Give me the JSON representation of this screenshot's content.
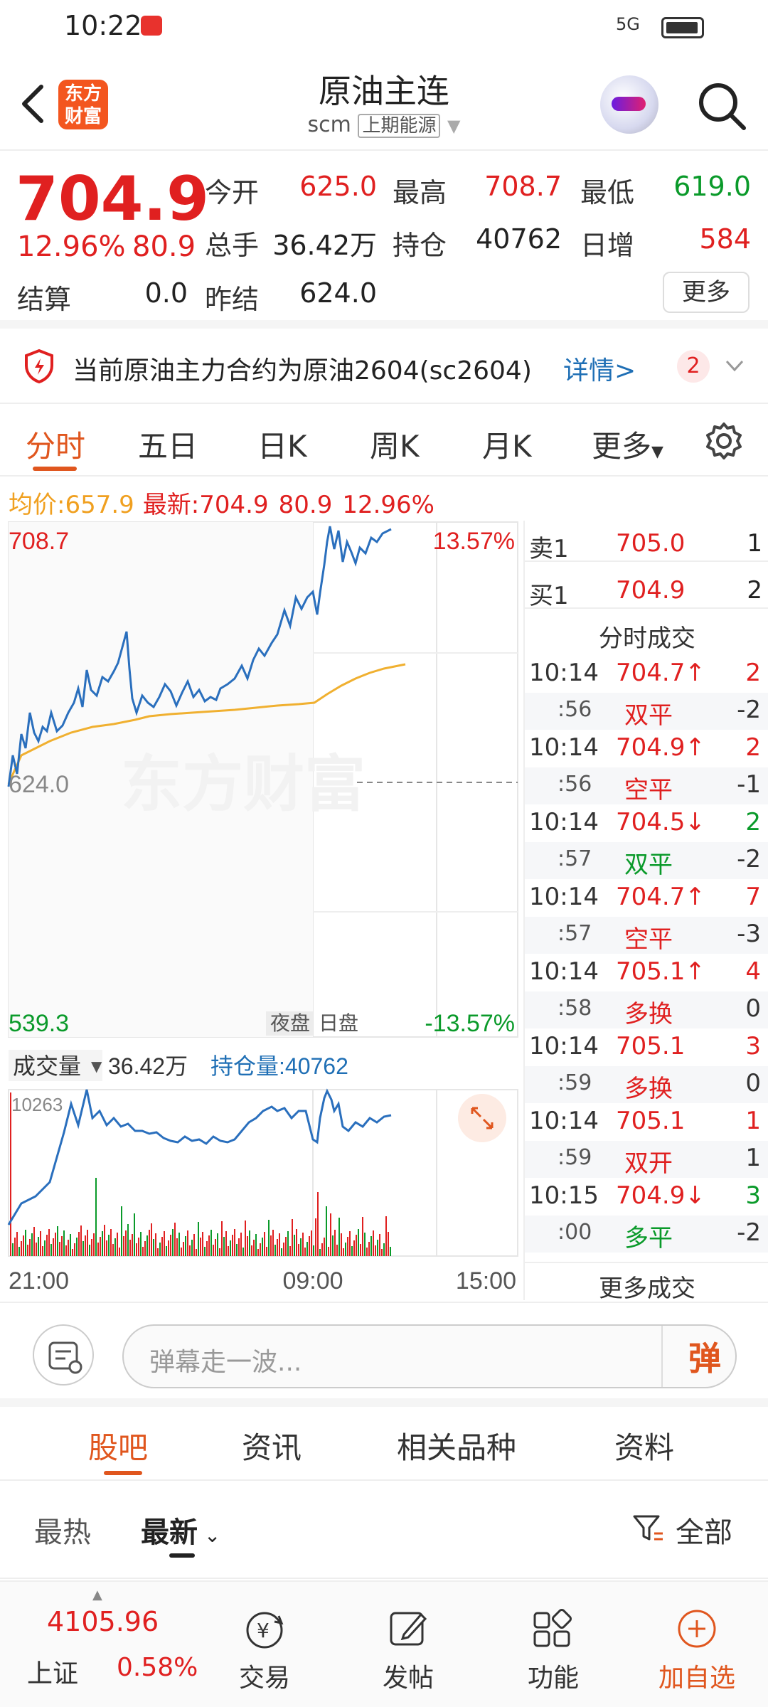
{
  "status": {
    "time": "10:22",
    "signal": "5G"
  },
  "header": {
    "logo": "东方\n财富",
    "title": "原油主连",
    "code": "scm",
    "exchange": "上期能源"
  },
  "quote": {
    "price": "704.9",
    "change_pct": "12.96%",
    "change": "80.9",
    "labels": {
      "open": "今开",
      "high": "最高",
      "low": "最低",
      "volume": "总手",
      "oi": "持仓",
      "daily_inc": "日增",
      "settle": "结算",
      "prev_settle": "昨结"
    },
    "open": "625.0",
    "high": "708.7",
    "low": "619.0",
    "volume": "36.42万",
    "oi": "40762",
    "daily_inc": "584",
    "settle": "0.0",
    "prev_settle": "624.0",
    "more_label": "更多"
  },
  "notice": {
    "text": "当前原油主力合约为原油2604(sc2604)",
    "link": "详情>",
    "badge": "2"
  },
  "tabs": [
    "分时",
    "五日",
    "日K",
    "周K",
    "月K",
    "更多"
  ],
  "avg": {
    "avg_label": "均价:",
    "avg_value": "657.9",
    "latest_label": "最新:",
    "latest_value": "704.9",
    "latest_change": "80.9",
    "latest_pct": "12.96%"
  },
  "chart": {
    "price_max": "708.7",
    "price_min": "539.3",
    "pct_max": "13.57%",
    "pct_min": "-13.57%",
    "prev_close": "624.0",
    "watermark": "东方财富",
    "session_night": "夜盘",
    "session_day": "日盘",
    "vol_selector": "成交量",
    "vol_value": "36.42万",
    "oi_label": "持仓量:40762",
    "vol_max": "10263",
    "x_ticks": [
      "21:00",
      "09:00",
      "15:00"
    ]
  },
  "orderbook": {
    "ask": {
      "label": "卖1",
      "price": "705.0",
      "vol": "1"
    },
    "bid": {
      "label": "买1",
      "price": "704.9",
      "vol": "2"
    },
    "trades_title": "分时成交",
    "trades": [
      {
        "time": "10:14",
        "price": "704.7↑",
        "vol": "2",
        "sec": ":56",
        "type": "双平",
        "oi": "-2",
        "pcolor": "red",
        "tcolor": "red"
      },
      {
        "time": "10:14",
        "price": "704.9↑",
        "vol": "2",
        "sec": ":56",
        "type": "空平",
        "oi": "-1",
        "pcolor": "red",
        "tcolor": "red"
      },
      {
        "time": "10:14",
        "price": "704.5↓",
        "vol": "2",
        "sec": ":57",
        "type": "双平",
        "oi": "-2",
        "pcolor": "red",
        "tcolor": "green"
      },
      {
        "time": "10:14",
        "price": "704.7↑",
        "vol": "7",
        "sec": ":57",
        "type": "空平",
        "oi": "-3",
        "pcolor": "red",
        "tcolor": "red"
      },
      {
        "time": "10:14",
        "price": "705.1↑",
        "vol": "4",
        "sec": ":58",
        "type": "多换",
        "oi": "0",
        "pcolor": "red",
        "tcolor": "red"
      },
      {
        "time": "10:14",
        "price": "705.1",
        "vol": "3",
        "sec": ":59",
        "type": "多换",
        "oi": "0",
        "pcolor": "red",
        "tcolor": "red"
      },
      {
        "time": "10:14",
        "price": "705.1",
        "vol": "1",
        "sec": ":59",
        "type": "双开",
        "oi": "1",
        "pcolor": "red",
        "tcolor": "red"
      },
      {
        "time": "10:15",
        "price": "704.9↓",
        "vol": "3",
        "sec": ":00",
        "type": "多平",
        "oi": "-2",
        "pcolor": "red",
        "tcolor": "green"
      }
    ],
    "more_trades": "更多成交"
  },
  "comment": {
    "placeholder": "弹幕走一波...",
    "send": "弹"
  },
  "sections": [
    "股吧",
    "资讯",
    "相关品种",
    "资料"
  ],
  "sort": {
    "hot": "最热",
    "new": "最新",
    "filter": "全部"
  },
  "bottomnav": {
    "index_value": "4105.96",
    "index_name": "上证",
    "index_pct": "0.58%",
    "items": [
      "交易",
      "发帖",
      "功能",
      "加自选"
    ]
  },
  "colors": {
    "up": "#e02020",
    "down": "#0a9a2a",
    "accent": "#e0561e",
    "link": "#1f6fb5",
    "avg_line": "#f0b030",
    "price_line": "#2a6fbd"
  }
}
